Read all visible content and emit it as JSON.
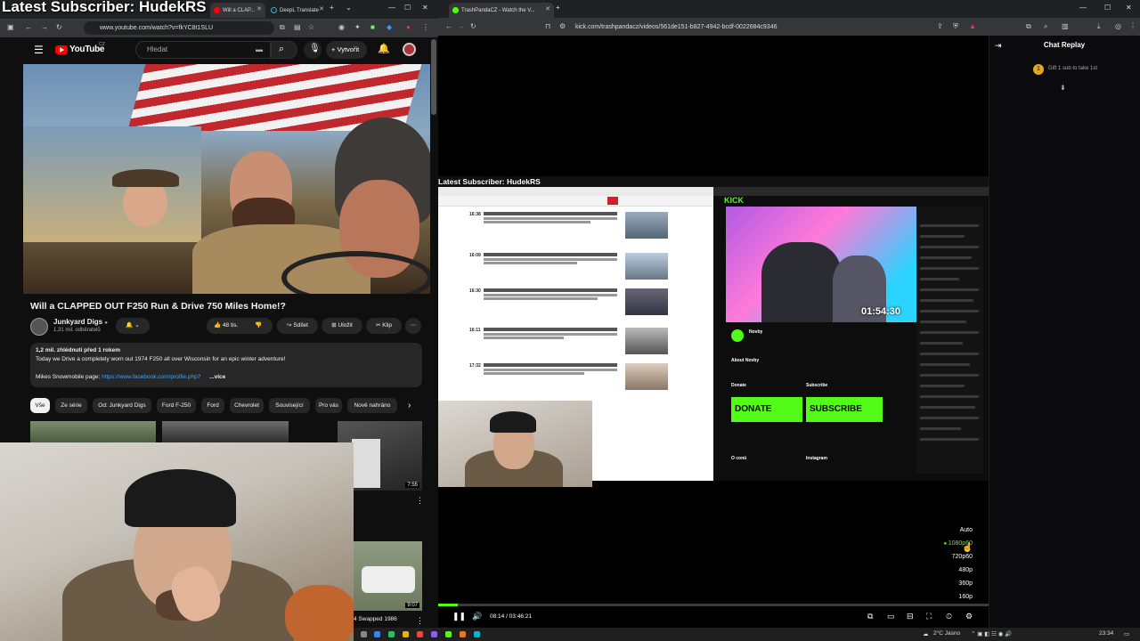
{
  "overlay": {
    "title": "Latest Subscriber: HudekRS"
  },
  "left_browser": {
    "tabs": [
      {
        "label": "Will a CLAP...",
        "color": "#ff0000",
        "active": true
      },
      {
        "label": "DeepL Translate",
        "color": "#0f2b46",
        "active": false
      }
    ],
    "url": "www.youtube.com/watch?v=fkYC8t1SLU"
  },
  "youtube": {
    "logo": "YouTube",
    "logo_suffix": "CZ",
    "search_placeholder": "Hledat",
    "create_label": "Vytvořit",
    "video_title": "Will a CLAPPED OUT F250 Run & Drive 750 Miles Home!?",
    "channel": {
      "name": "Junkyard Digs",
      "subs": "1,31 mil. odběratelů"
    },
    "likes": "48 tis.",
    "actions": {
      "share": "Sdílet",
      "save": "Uložit",
      "clip": "Klip"
    },
    "description": {
      "stats": "1,2 mil. zhlédnutí  před 1 rokem",
      "line1": "Today we Drive a completely worn out 1974 F250 all over Wisconsin for an epic winter adventure!",
      "line2_prefix": "Mikes Snowmobile page:",
      "line2_link": "https://www.facebook.com/profile.php?",
      "more": "...více"
    },
    "chips": [
      "Vše",
      "Ze série",
      "Od: Junkyard Digs",
      "Ford F-250",
      "Ford",
      "Chevrolet",
      "Související",
      "Pro vás",
      "Nově nahráno"
    ],
    "thumb_durations": [
      "7:55",
      "9:07"
    ],
    "thumb_title": "4 Swapped 1986"
  },
  "right_browser": {
    "tab_label": "TrashPandaCZ - Watch the V...",
    "url": "kick.com/trashpandacz/videos/561de151-b827-4942-bcdf-0022684c9346"
  },
  "chat": {
    "title": "Chat Replay",
    "gift_badge": "1",
    "gift_text": "Gift 1 sub to take 1st"
  },
  "inner_stream": {
    "title": "Latest Subscriber: HudekRS",
    "news_times": [
      "16:38",
      "16:09",
      "16:30",
      "16:11",
      "17:32"
    ],
    "kick_logo": "KICK",
    "timer": "01:54:30",
    "streamer": "Novby",
    "donate": "DONATE",
    "subscribe": "SUBSCRIBE",
    "about": "About Novby",
    "donate_heading": "Donate",
    "subscribe_heading": "Subscribe",
    "oconi": "O conü",
    "instagram": "Instagram"
  },
  "player": {
    "time": "08:14 / 03:46:21",
    "progress": 0.036,
    "quality_options": [
      "Auto",
      "1080p60",
      "720p60",
      "480p",
      "360p",
      "160p"
    ],
    "quality_selected": "1080p60"
  },
  "taskbar": {
    "weather": "2°C Jasno",
    "clock": "23:34"
  },
  "colors": {
    "kick_green": "#53fc18",
    "yt_red": "#ff0000",
    "yt_bg": "#0f0f0f"
  }
}
